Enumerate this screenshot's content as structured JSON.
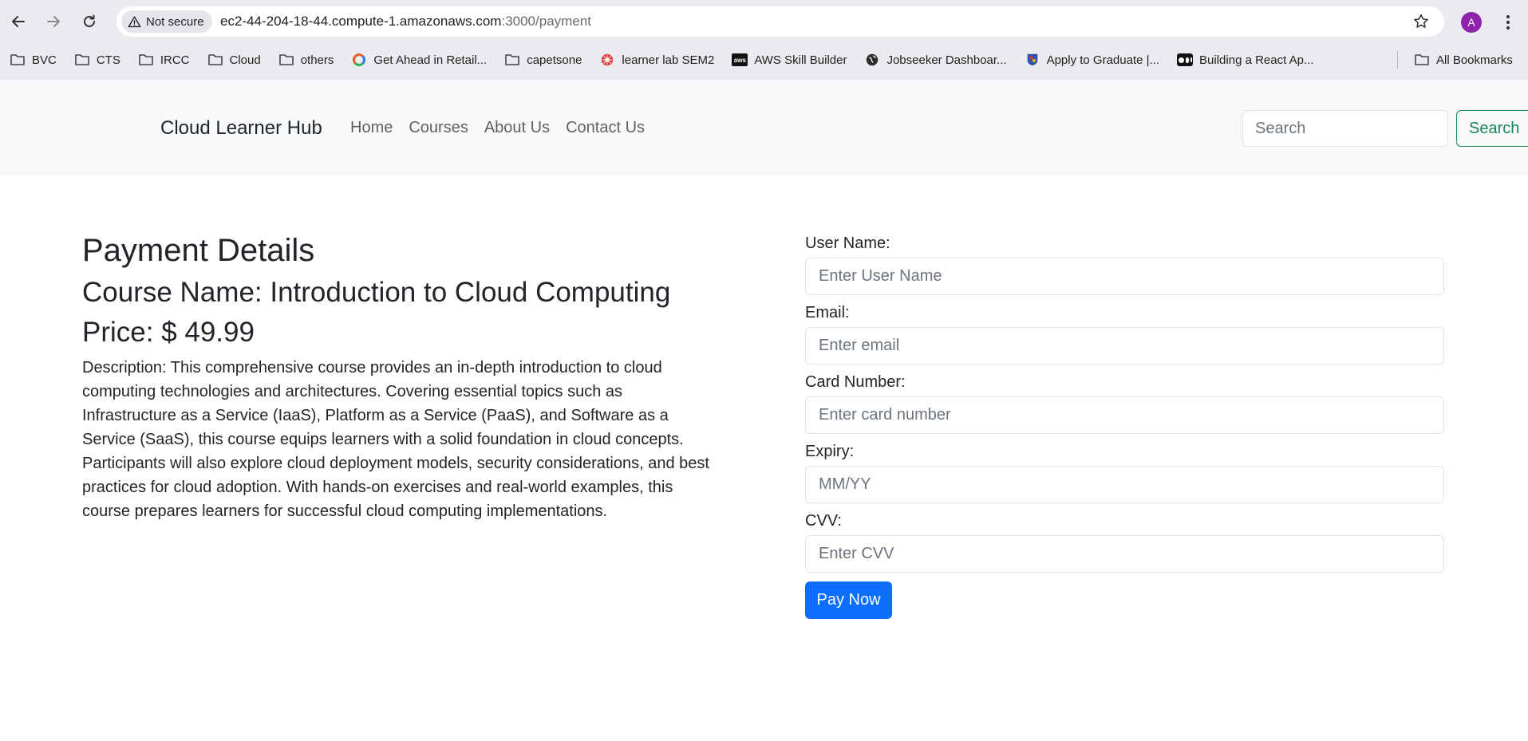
{
  "browser": {
    "security_label": "Not secure",
    "url_host": "ec2-44-204-18-44.compute-1.amazonaws.com",
    "url_path": ":3000/payment",
    "profile_initial": "A",
    "profile_color": "#8e24aa",
    "bookmarks": [
      {
        "label": "BVC",
        "icon": "folder-icon"
      },
      {
        "label": "CTS",
        "icon": "folder-icon"
      },
      {
        "label": "IRCC",
        "icon": "folder-icon"
      },
      {
        "label": "Cloud",
        "icon": "folder-icon"
      },
      {
        "label": "others",
        "icon": "folder-icon"
      },
      {
        "label": "Get Ahead in Retail...",
        "icon": "ring-favicon"
      },
      {
        "label": "capetsone",
        "icon": "folder-icon"
      },
      {
        "label": "learner lab SEM2",
        "icon": "red-wheel-favicon"
      },
      {
        "label": "AWS Skill Builder",
        "icon": "aws-favicon"
      },
      {
        "label": "Jobseeker Dashboar...",
        "icon": "globe-favicon"
      },
      {
        "label": "Apply to Graduate |...",
        "icon": "crest-favicon"
      },
      {
        "label": "Building a React Ap...",
        "icon": "medium-favicon"
      }
    ],
    "all_bookmarks_label": "All Bookmarks"
  },
  "navbar": {
    "brand": "Cloud Learner Hub",
    "links": [
      "Home",
      "Courses",
      "About Us",
      "Contact Us"
    ],
    "search_placeholder": "Search",
    "search_button": "Search"
  },
  "payment": {
    "heading": "Payment Details",
    "course_name": "Course Name: Introduction to Cloud Computing",
    "price": "Price: $ 49.99",
    "description": "Description: This comprehensive course provides an in-depth introduction to cloud computing technologies and architectures. Covering essential topics such as Infrastructure as a Service (IaaS), Platform as a Service (PaaS), and Software as a Service (SaaS), this course equips learners with a solid foundation in cloud concepts. Participants will also explore cloud deployment models, security considerations, and best practices for cloud adoption. With hands-on exercises and real-world examples, this course prepares learners for successful cloud computing implementations."
  },
  "form": {
    "username_label": "User Name:",
    "username_placeholder": "Enter User Name",
    "email_label": "Email:",
    "email_placeholder": "Enter email",
    "card_label": "Card Number:",
    "card_placeholder": "Enter card number",
    "expiry_label": "Expiry:",
    "expiry_placeholder": "MM/YY",
    "cvv_label": "CVV:",
    "cvv_placeholder": "Enter CVV",
    "submit_label": "Pay Now"
  },
  "colors": {
    "primary": "#0d6efd",
    "success": "#198754",
    "navbar_bg": "#f8f9fa"
  }
}
